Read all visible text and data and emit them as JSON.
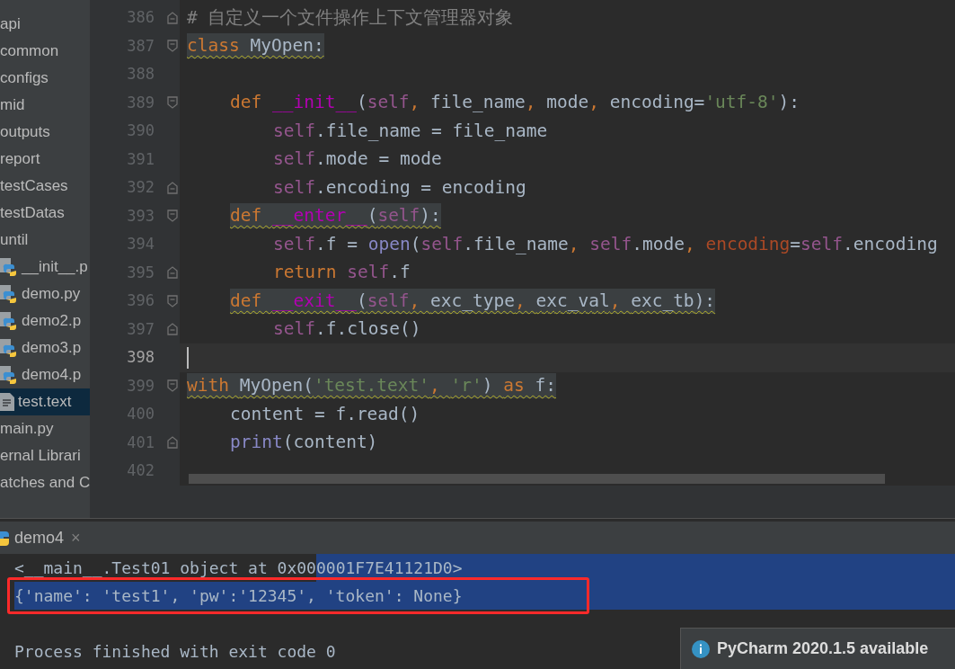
{
  "project_tree": [
    {
      "label": "api",
      "selected": false
    },
    {
      "label": "common",
      "selected": false
    },
    {
      "label": "configs",
      "selected": false
    },
    {
      "label": "mid",
      "selected": false
    },
    {
      "label": "outputs",
      "selected": false
    },
    {
      "label": "report",
      "selected": false
    },
    {
      "label": "testCases",
      "selected": false
    },
    {
      "label": "testDatas",
      "selected": false
    },
    {
      "label": "until",
      "selected": false,
      "children": [
        {
          "label": "__init__.p",
          "kind": "python",
          "selected": false
        },
        {
          "label": "demo.py",
          "kind": "python",
          "selected": false
        },
        {
          "label": "demo2.p",
          "kind": "python",
          "selected": false
        },
        {
          "label": "demo3.p",
          "kind": "python",
          "selected": false
        },
        {
          "label": "demo4.p",
          "kind": "python",
          "selected": false
        },
        {
          "label": "test.text",
          "kind": "text",
          "selected": true
        }
      ]
    },
    {
      "label": "main.py",
      "selected": false
    },
    {
      "label": "ernal Librari",
      "selected": false
    },
    {
      "label": "atches and C",
      "selected": false
    }
  ],
  "editor": {
    "lines": [
      {
        "number": "386",
        "indented": false,
        "nested": false,
        "tokens": [
          {
            "kind": "comment",
            "text": "# 自定义一个文件操作上下文管理器对象"
          }
        ],
        "fold_start": false,
        "fold_end": true,
        "warning": false,
        "current": false
      },
      {
        "number": "387",
        "indented": false,
        "nested": false,
        "tokens": [
          {
            "kind": "keyword",
            "text": "class "
          },
          {
            "kind": "plain",
            "text": "MyOpen:"
          }
        ],
        "fold_start": true,
        "fold_end": false,
        "warning": true,
        "current": false
      },
      {
        "number": "388",
        "fold_start": false,
        "fold_end": false,
        "current": false
      },
      {
        "number": "389",
        "indented": true,
        "nested": false,
        "tokens": [
          {
            "kind": "keyword",
            "text": "def "
          },
          {
            "kind": "magic",
            "text": "__init__"
          },
          {
            "kind": "plain",
            "text": "("
          },
          {
            "kind": "self",
            "text": "self"
          },
          {
            "kind": "keyword",
            "text": ", "
          },
          {
            "kind": "plain",
            "text": "file_name"
          },
          {
            "kind": "keyword",
            "text": ", "
          },
          {
            "kind": "plain",
            "text": "mode"
          },
          {
            "kind": "keyword",
            "text": ", "
          },
          {
            "kind": "plain",
            "text": "encoding="
          },
          {
            "kind": "string",
            "text": "'utf-8'"
          },
          {
            "kind": "plain",
            "text": "):"
          }
        ],
        "fold_start": true,
        "fold_end": false,
        "warning": false,
        "current": false
      },
      {
        "number": "390",
        "indented": true,
        "nested": true,
        "tokens": [
          {
            "kind": "self",
            "text": "self"
          },
          {
            "kind": "plain",
            "text": ".file_name = file_name"
          }
        ],
        "fold_start": false,
        "fold_end": false,
        "warning": false,
        "current": false
      },
      {
        "number": "391",
        "indented": true,
        "nested": true,
        "tokens": [
          {
            "kind": "self",
            "text": "self"
          },
          {
            "kind": "plain",
            "text": ".mode = mode"
          }
        ],
        "fold_start": false,
        "fold_end": false,
        "warning": false,
        "current": false
      },
      {
        "number": "392",
        "indented": true,
        "nested": true,
        "tokens": [
          {
            "kind": "self",
            "text": "self"
          },
          {
            "kind": "plain",
            "text": ".encoding = encoding"
          }
        ],
        "fold_start": false,
        "fold_end": true,
        "warning": false,
        "current": false
      },
      {
        "number": "393",
        "indented": true,
        "nested": false,
        "tokens": [
          {
            "kind": "keyword",
            "text": "def "
          },
          {
            "kind": "magic",
            "text": "__enter__"
          },
          {
            "kind": "plain",
            "text": "("
          },
          {
            "kind": "self",
            "text": "self"
          },
          {
            "kind": "plain",
            "text": "):"
          }
        ],
        "fold_start": true,
        "fold_end": false,
        "warning": true,
        "current": false
      },
      {
        "number": "394",
        "indented": true,
        "nested": true,
        "tokens": [
          {
            "kind": "self",
            "text": "self"
          },
          {
            "kind": "plain",
            "text": ".f = "
          },
          {
            "kind": "builtin",
            "text": "open"
          },
          {
            "kind": "plain",
            "text": "("
          },
          {
            "kind": "self",
            "text": "self"
          },
          {
            "kind": "plain",
            "text": ".file_name"
          },
          {
            "kind": "keyword",
            "text": ", "
          },
          {
            "kind": "self",
            "text": "self"
          },
          {
            "kind": "plain",
            "text": ".mode"
          },
          {
            "kind": "keyword",
            "text": ", "
          },
          {
            "kind": "param",
            "text": "encoding"
          },
          {
            "kind": "plain",
            "text": "="
          },
          {
            "kind": "self",
            "text": "self"
          },
          {
            "kind": "plain",
            "text": ".encoding"
          }
        ],
        "fold_start": false,
        "fold_end": false,
        "warning": false,
        "current": false
      },
      {
        "number": "395",
        "indented": true,
        "nested": true,
        "tokens": [
          {
            "kind": "keyword",
            "text": "return "
          },
          {
            "kind": "self",
            "text": "self"
          },
          {
            "kind": "plain",
            "text": ".f"
          }
        ],
        "fold_start": false,
        "fold_end": true,
        "warning": false,
        "current": false
      },
      {
        "number": "396",
        "indented": true,
        "nested": false,
        "tokens": [
          {
            "kind": "keyword",
            "text": "def "
          },
          {
            "kind": "magic",
            "text": "__exit__"
          },
          {
            "kind": "plain",
            "text": "("
          },
          {
            "kind": "self",
            "text": "self"
          },
          {
            "kind": "keyword",
            "text": ", "
          },
          {
            "kind": "plain",
            "text": "exc_type"
          },
          {
            "kind": "keyword",
            "text": ", "
          },
          {
            "kind": "plain",
            "text": "exc_val"
          },
          {
            "kind": "keyword",
            "text": ", "
          },
          {
            "kind": "plain",
            "text": "exc_tb"
          },
          {
            "kind": "plain",
            "text": "):"
          }
        ],
        "fold_start": true,
        "fold_end": false,
        "warning": true,
        "current": false
      },
      {
        "number": "397",
        "indented": true,
        "nested": true,
        "tokens": [
          {
            "kind": "self",
            "text": "self"
          },
          {
            "kind": "plain",
            "text": ".f.close()"
          }
        ],
        "fold_start": false,
        "fold_end": true,
        "warning": false,
        "current": false
      },
      {
        "number": "398",
        "fold_start": false,
        "fold_end": false,
        "current": true
      },
      {
        "number": "399",
        "indented": false,
        "nested": false,
        "tokens": [
          {
            "kind": "keyword",
            "text": "with "
          },
          {
            "kind": "plain",
            "text": "MyOpen("
          },
          {
            "kind": "string",
            "text": "'test.text'"
          },
          {
            "kind": "keyword",
            "text": ", "
          },
          {
            "kind": "string",
            "text": "'r'"
          },
          {
            "kind": "plain",
            "text": ") "
          },
          {
            "kind": "keyword",
            "text": "as "
          },
          {
            "kind": "plain",
            "text": "f:"
          }
        ],
        "fold_start": true,
        "fold_end": false,
        "warning": true,
        "current": false
      },
      {
        "number": "400",
        "indented": true,
        "nested": false,
        "tokens": [
          {
            "kind": "plain",
            "text": "content = f.read()"
          }
        ],
        "fold_start": false,
        "fold_end": false,
        "warning": false,
        "current": false
      },
      {
        "number": "401",
        "indented": true,
        "nested": false,
        "tokens": [
          {
            "kind": "builtin",
            "text": "print"
          },
          {
            "kind": "plain",
            "text": "(content)"
          }
        ],
        "fold_start": false,
        "fold_end": true,
        "warning": false,
        "current": false
      },
      {
        "number": "402",
        "fold_start": false,
        "fold_end": false,
        "current": false
      }
    ]
  },
  "run_tab": {
    "label": "demo4",
    "close": "×"
  },
  "console": {
    "lines": [
      {
        "boxed": false,
        "segments": [
          {
            "text": "<__main__.Test01 object at 0x00",
            "selected": false
          },
          {
            "text": "0001F7E41121D0>",
            "selected": true
          }
        ],
        "selected_to_end": true,
        "space_before": false
      },
      {
        "boxed": true,
        "segments": [
          {
            "text": "{'name': 'test1', 'pw':'12345', 'token': None}",
            "selected": true
          }
        ],
        "selected_to_end": true,
        "space_before": false
      },
      {
        "boxed": false,
        "segments": [
          {
            "text": "Process finished with exit code 0",
            "selected": false
          }
        ],
        "selected_to_end": false,
        "space_before": true
      }
    ]
  },
  "notification": {
    "title": "PyCharm 2020.1.5 available"
  }
}
